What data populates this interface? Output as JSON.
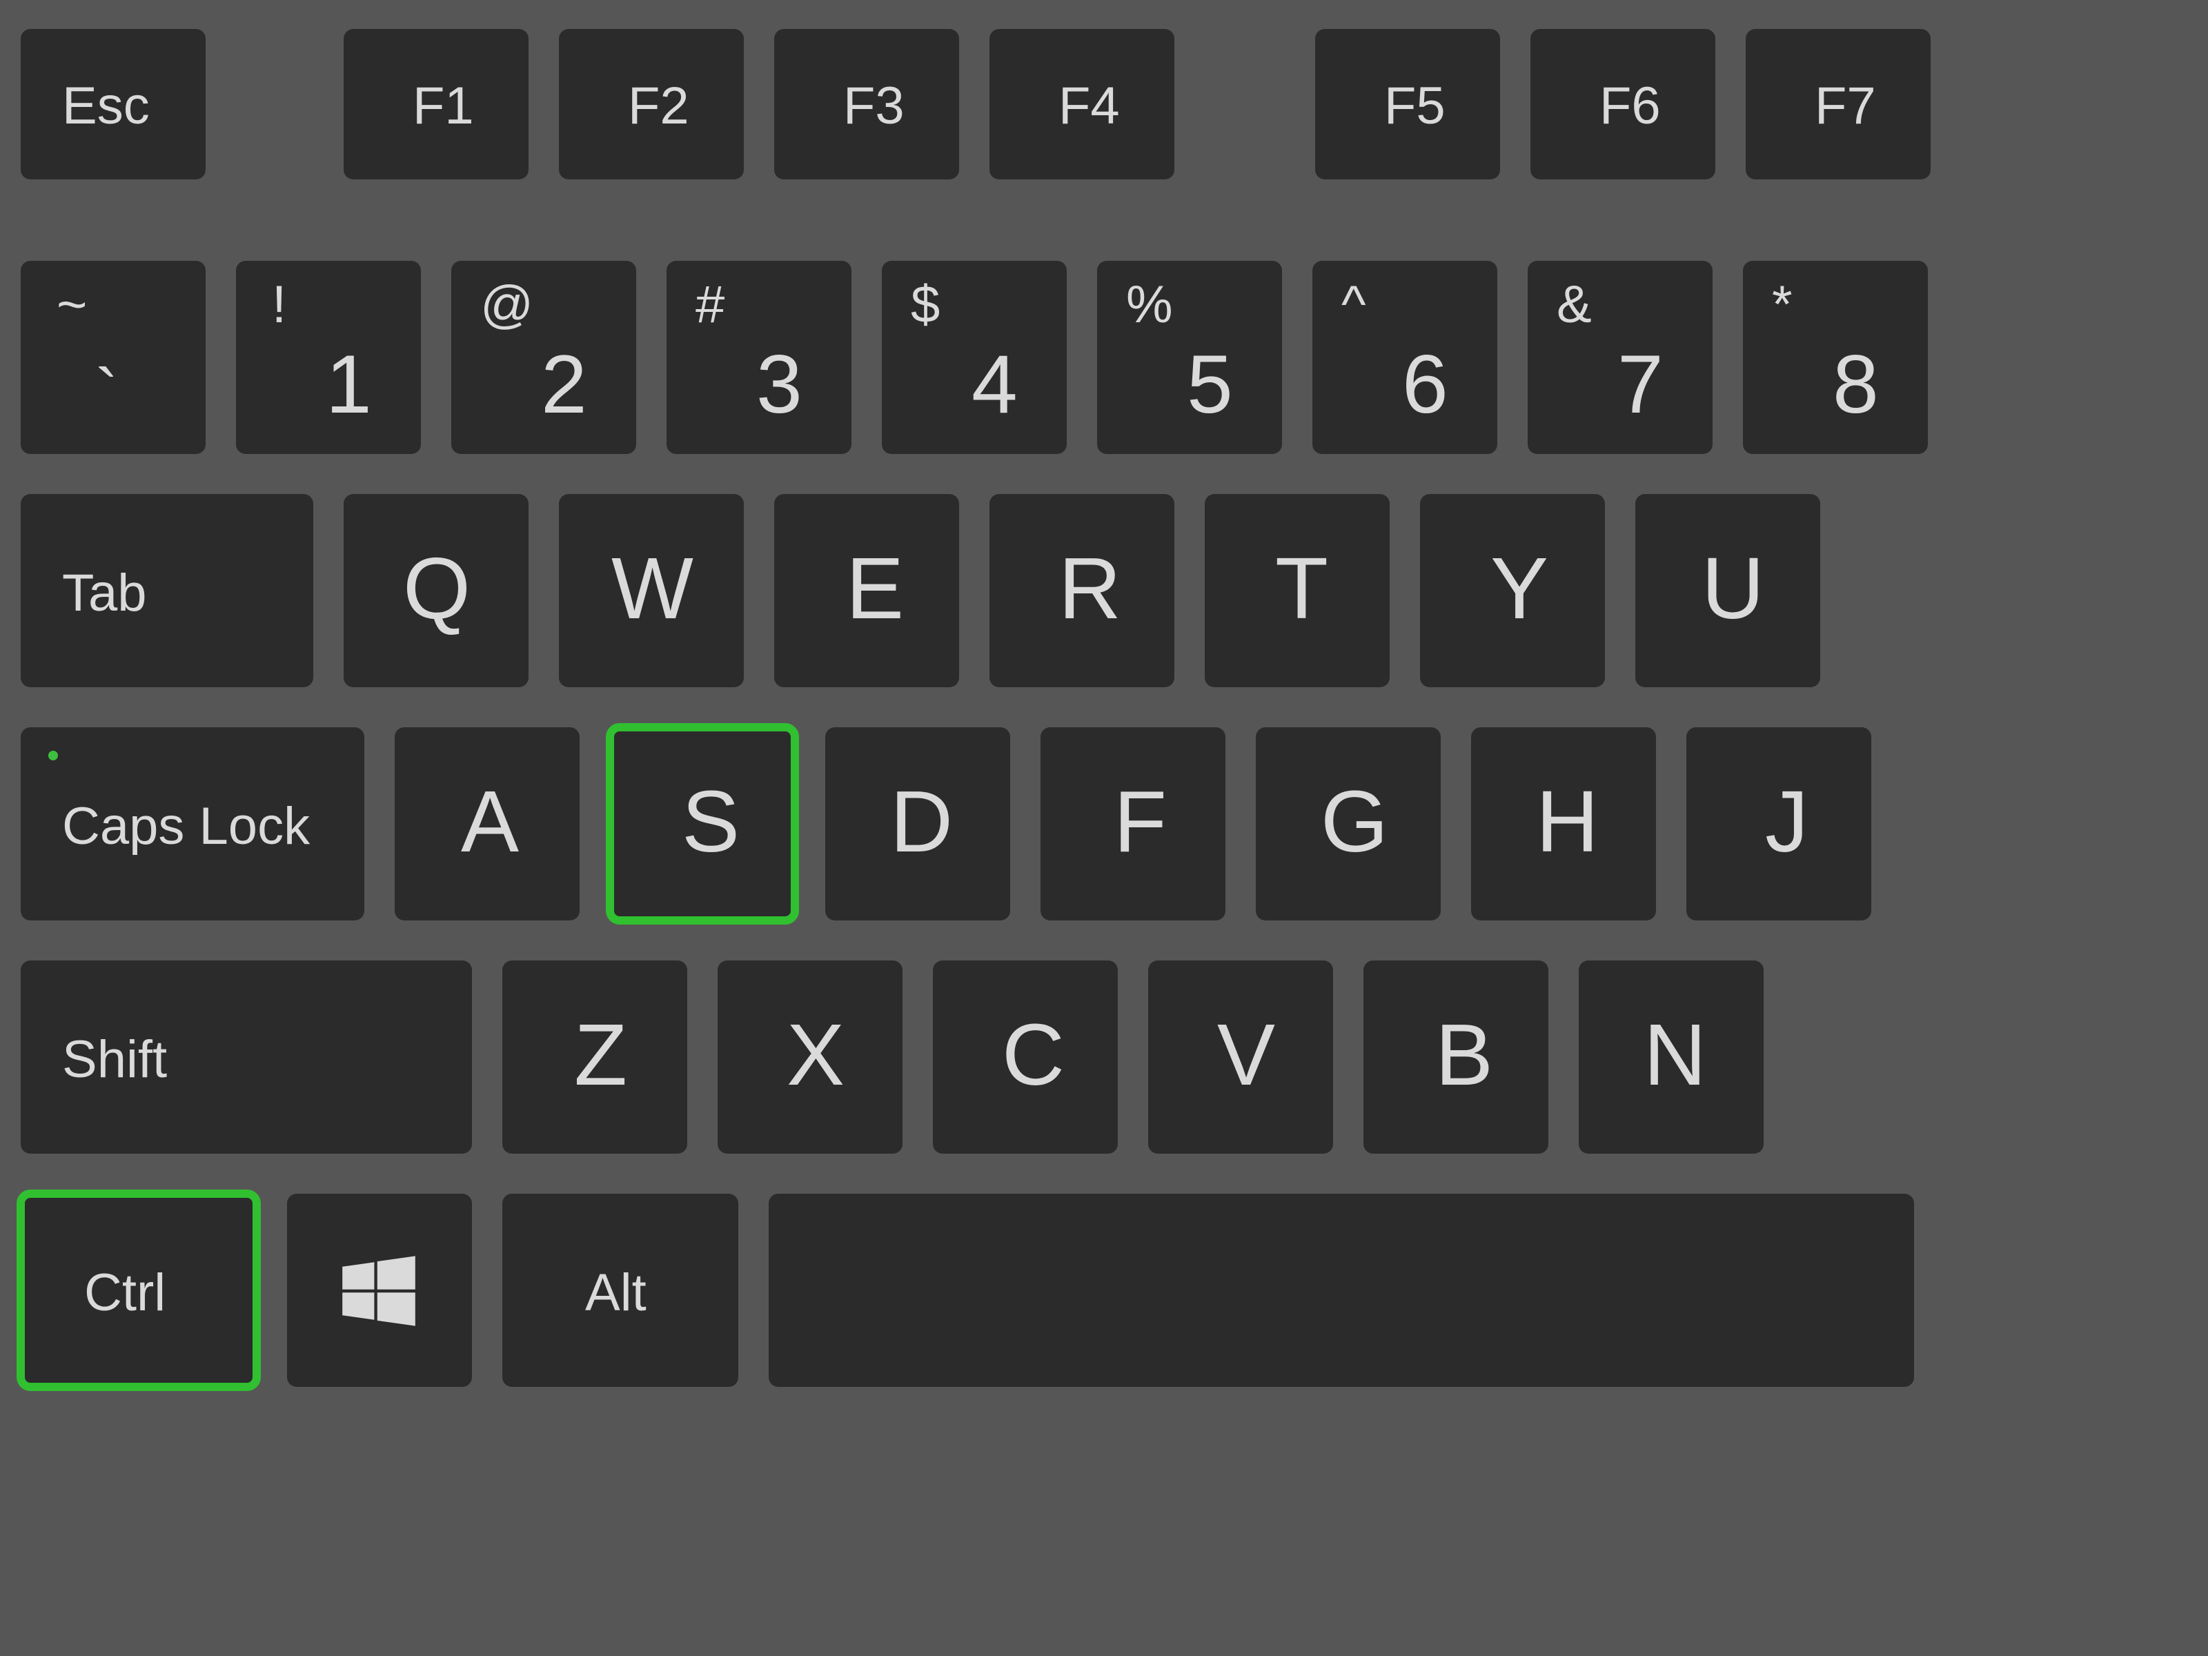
{
  "colors": {
    "bg": "#565656",
    "key": "#2B2B2B",
    "text": "#DADADA",
    "highlight": "#30C030",
    "led": "#3FBF3F"
  },
  "highlighted": [
    "s",
    "ctrl"
  ],
  "keys": {
    "esc": "Esc",
    "f1": "F1",
    "f2": "F2",
    "f3": "F3",
    "f4": "F4",
    "f5": "F5",
    "f6": "F6",
    "f7": "F7",
    "tilde_top": "~",
    "tilde_bot": "`",
    "1_top": "!",
    "1_bot": "1",
    "2_top": "@",
    "2_bot": "2",
    "3_top": "#",
    "3_bot": "3",
    "4_top": "$",
    "4_bot": "4",
    "5_top": "%",
    "5_bot": "5",
    "6_top": "^",
    "6_bot": "6",
    "7_top": "&",
    "7_bot": "7",
    "8_top": "*",
    "8_bot": "8",
    "tab": "Tab",
    "q": "Q",
    "w": "W",
    "e": "E",
    "r": "R",
    "t": "T",
    "y": "Y",
    "u": "U",
    "caps": "Caps Lock",
    "a": "A",
    "s": "S",
    "d": "D",
    "f": "F",
    "g": "G",
    "h": "H",
    "j": "J",
    "shift": "Shift",
    "z": "Z",
    "x": "X",
    "c": "C",
    "v": "V",
    "b": "B",
    "n": "N",
    "ctrl": "Ctrl",
    "win": "",
    "alt": "Alt"
  }
}
